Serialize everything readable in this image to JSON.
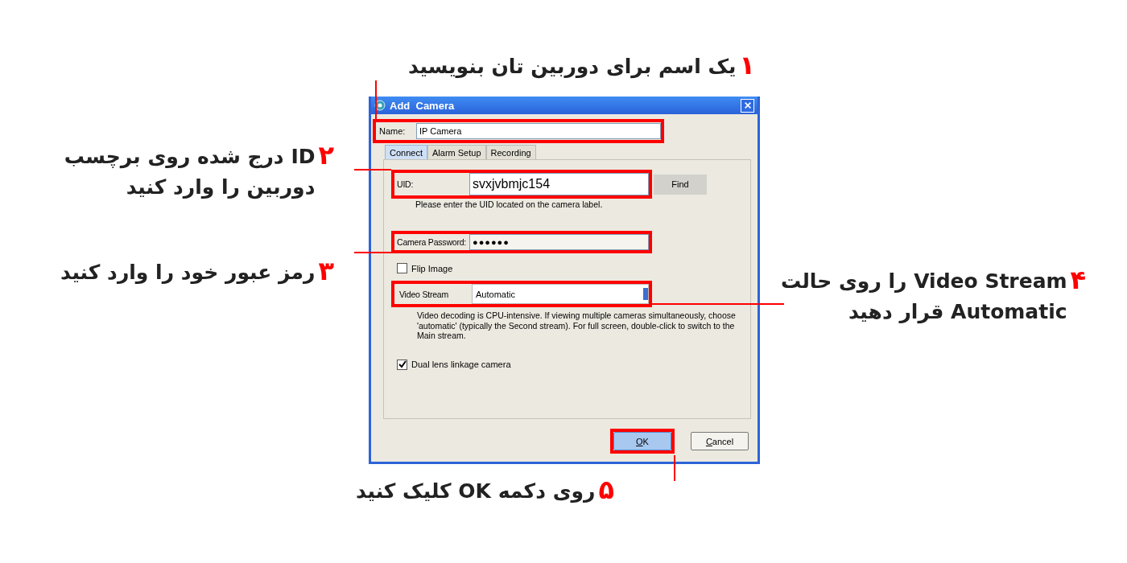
{
  "callouts": [
    {
      "number": "۱",
      "lines": [
        "یک اسم برای دوربین تان بنویسید"
      ]
    },
    {
      "number": "۲",
      "lines": [
        "ID درج شده روی برچسب",
        "دوربین را وارد کنید"
      ]
    },
    {
      "number": "۳",
      "lines": [
        "رمز عبور خود را وارد کنید"
      ]
    },
    {
      "number": "۴",
      "lines": [
        "Video Stream را روی حالت",
        "Automatic قرار دهید"
      ]
    },
    {
      "number": "۵",
      "lines": [
        "روی دکمه OK کلیک کنید"
      ]
    }
  ],
  "window": {
    "title": "Add  Camera"
  },
  "name_field": {
    "label": "Name:",
    "value": "IP Camera",
    "highlighted": true
  },
  "tabs": [
    {
      "label": "Connect",
      "selected": true
    },
    {
      "label": "Alarm Setup",
      "selected": false
    },
    {
      "label": "Recording",
      "selected": false
    }
  ],
  "uid_field": {
    "label": "UID:",
    "value": "svxjvbmjc154",
    "highlighted": true,
    "button": "Find",
    "hint": "Please enter the UID located on the camera label."
  },
  "password_field": {
    "label": "Camera Password:",
    "value": "●●●●●●",
    "highlighted": true
  },
  "flip_image": {
    "label": "Flip Image",
    "checked": false
  },
  "video_stream": {
    "label": "Video Stream",
    "value": "Automatic",
    "highlighted": true,
    "description": "Video decoding is CPU-intensive. If viewing multiple cameras simultaneously, choose 'automatic' (typically the Second stream). For full screen, double-click to switch to the Main stream."
  },
  "dual_lens": {
    "label": "Dual lens linkage camera",
    "checked": true
  },
  "buttons": [
    {
      "label": "OK",
      "highlighted": true,
      "default": true
    },
    {
      "label": "Cancel",
      "highlighted": false,
      "default": false
    }
  ]
}
